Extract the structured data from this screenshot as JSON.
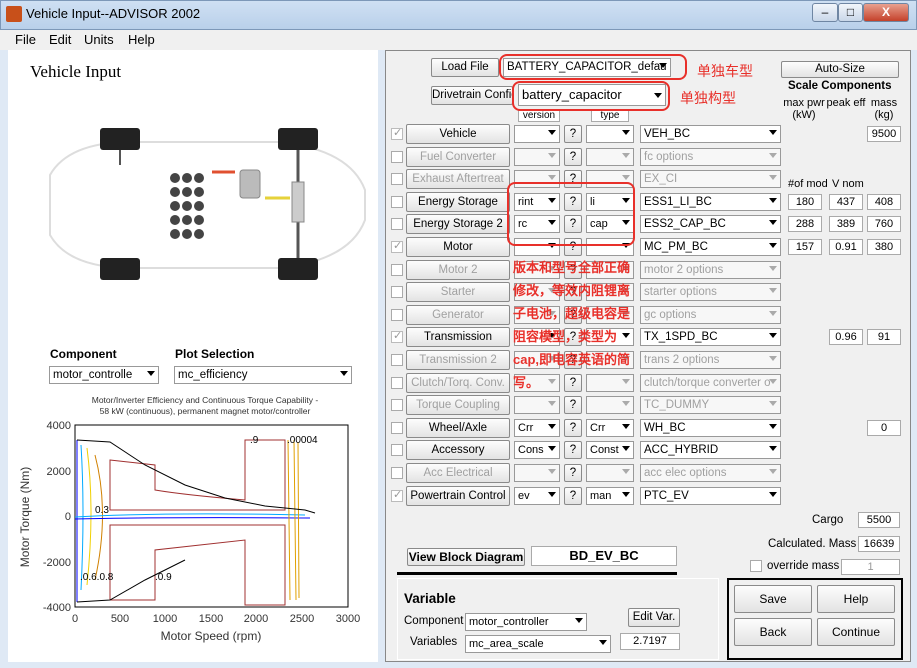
{
  "window": {
    "title": "Vehicle Input--ADVISOR 2002",
    "minimize": "–",
    "maximize": "□",
    "close": "X"
  },
  "menu": [
    "File",
    "Edit",
    "Units",
    "Help"
  ],
  "left": {
    "heading": "Vehicle Input",
    "component_label": "Component",
    "plot_label": "Plot Selection",
    "component_value": "motor_controlle",
    "plot_value": "mc_efficiency",
    "plot": {
      "title_line1": "Motor/Inverter Efficiency and Continuous Torque Capability -",
      "title_line2": "58 kW (continuous), permanent magnet motor/controller",
      "xlabel": "Motor Speed (rpm)",
      "ylabel": "Motor Torque (Nm)",
      "xticks": [
        "0",
        "500",
        "1000",
        "1500",
        "2000",
        "2500",
        "3000"
      ],
      "yticks": [
        "4000",
        "2000",
        "0",
        "-2000",
        "-4000"
      ],
      "contour_labels": [
        ".9",
        "0.3",
        ".0.6.0.8",
        ".0.9",
        ".00004"
      ]
    }
  },
  "right": {
    "load_file": "Load File",
    "load_file_value": "BATTERY_CAPACITOR_defau",
    "drivetrain_config": "Drivetrain Config",
    "drivetrain_value": "battery_capacitor",
    "version_hdr": "version",
    "type_hdr": "type",
    "auto_size": "Auto-Size",
    "scale_components": "Scale Components",
    "max_pwr": "max pwr (kW)",
    "peak_eff": "peak eff",
    "mass": "mass (kg)",
    "num_mod": "#of mod",
    "v_nom": "V nom",
    "rows": [
      {
        "label": "Vehicle",
        "enabled": true,
        "checked": true,
        "ver": "",
        "type": "",
        "comp": "VEH_BC",
        "max": "",
        "peak": "",
        "mass": "9500"
      },
      {
        "label": "Fuel Converter",
        "enabled": false,
        "checked": false,
        "ver": "",
        "type": "",
        "comp": "fc options",
        "max": "",
        "peak": "",
        "mass": ""
      },
      {
        "label": "Exhaust Aftertreat",
        "enabled": false,
        "checked": false,
        "ver": "",
        "type": "",
        "comp": "EX_CI",
        "max": "",
        "peak": "",
        "mass": ""
      },
      {
        "label": "Energy Storage",
        "enabled": true,
        "checked": false,
        "ver": "rint",
        "type": "li",
        "comp": "ESS1_LI_BC",
        "max": "180",
        "peak": "437",
        "mass": "408"
      },
      {
        "label": "Energy Storage 2",
        "enabled": true,
        "checked": false,
        "ver": "rc",
        "type": "cap",
        "comp": "ESS2_CAP_BC",
        "max": "288",
        "peak": "389",
        "mass": "760"
      },
      {
        "label": "Motor",
        "enabled": true,
        "checked": true,
        "ver": "",
        "type": "",
        "comp": "MC_PM_BC",
        "max": "157",
        "peak": "0.91",
        "mass": "380"
      },
      {
        "label": "Motor 2",
        "enabled": false,
        "checked": false,
        "ver": "",
        "type": "",
        "comp": "motor 2 options",
        "max": "",
        "peak": "",
        "mass": ""
      },
      {
        "label": "Starter",
        "enabled": false,
        "checked": false,
        "ver": "",
        "type": "",
        "comp": "starter options",
        "max": "",
        "peak": "",
        "mass": ""
      },
      {
        "label": "Generator",
        "enabled": false,
        "checked": false,
        "ver": "",
        "type": "",
        "comp": "gc options",
        "max": "",
        "peak": "",
        "mass": ""
      },
      {
        "label": "Transmission",
        "enabled": true,
        "checked": true,
        "ver": "",
        "type": "",
        "comp": "TX_1SPD_BC",
        "max": "",
        "peak": "0.96",
        "mass": "91"
      },
      {
        "label": "Transmission 2",
        "enabled": false,
        "checked": false,
        "ver": "",
        "type": "",
        "comp": "trans 2 options",
        "max": "",
        "peak": "",
        "mass": ""
      },
      {
        "label": "Clutch/Torq. Conv.",
        "enabled": false,
        "checked": false,
        "ver": "",
        "type": "",
        "comp": "clutch/torque converter o",
        "max": "",
        "peak": "",
        "mass": ""
      },
      {
        "label": "Torque Coupling",
        "enabled": false,
        "checked": false,
        "ver": "",
        "type": "",
        "comp": "TC_DUMMY",
        "max": "",
        "peak": "",
        "mass": ""
      },
      {
        "label": "Wheel/Axle",
        "enabled": true,
        "checked": false,
        "ver": "Crr",
        "type": "Crr",
        "comp": "WH_BC",
        "max": "",
        "peak": "",
        "mass": "0"
      },
      {
        "label": "Accessory",
        "enabled": true,
        "checked": false,
        "ver": "Cons",
        "type": "Const",
        "comp": "ACC_HYBRID",
        "max": "",
        "peak": "",
        "mass": ""
      },
      {
        "label": "Acc Electrical",
        "enabled": false,
        "checked": false,
        "ver": "",
        "type": "",
        "comp": "acc elec options",
        "max": "",
        "peak": "",
        "mass": ""
      },
      {
        "label": "Powertrain Control",
        "enabled": true,
        "checked": true,
        "ver": "ev",
        "type": "man",
        "comp": "PTC_EV",
        "max": "",
        "peak": "",
        "mass": ""
      }
    ],
    "cargo_label": "Cargo",
    "cargo_value": "5500",
    "calc_mass_label": "Calculated. Mass",
    "calc_mass_value": "16639",
    "override_label": "override mass",
    "override_value": "1",
    "view_block": "View Block Diagram",
    "block_name": "BD_EV_BC",
    "variable_heading": "Variable",
    "var_component_label": "Component",
    "var_component_value": "motor_controller",
    "var_variables_label": "Variables",
    "var_variables_value": "mc_area_scale",
    "edit_var": "Edit Var.",
    "var_value": "2.7197",
    "save": "Save",
    "help": "Help",
    "back": "Back",
    "continue": "Continue"
  },
  "annotations": {
    "vehicle_type": "单独车型",
    "config_type": "单独构型",
    "note": [
      "版本和型号全部正确",
      "修改，等效内阻锂离",
      "子电池，超级电容是",
      "阻容模型，类型为",
      "cap,即电容英语的简",
      "写。"
    ]
  }
}
